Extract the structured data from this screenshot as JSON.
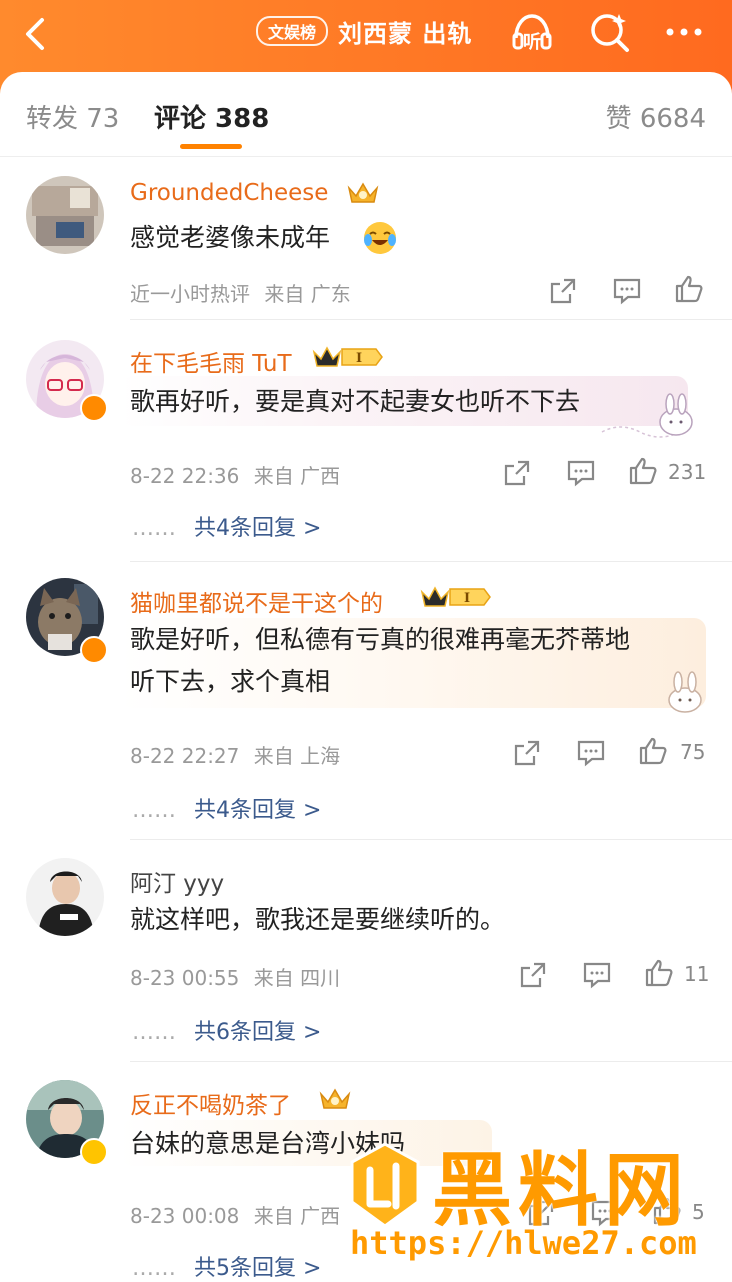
{
  "header": {
    "hot_tag": "文娱榜",
    "title": "刘西蒙 出轨",
    "listen_label": "听"
  },
  "tabs": {
    "repost": "转发 73",
    "comment": "评论 388",
    "like": "赞 6684"
  },
  "comments": [
    {
      "name": "GroundedCheese",
      "text": "感觉老婆像未成年",
      "time": "近一小时热评",
      "location": "来自 广东",
      "likes": "",
      "replies": ""
    },
    {
      "name": "在下毛毛雨 TuT",
      "text": "歌再好听，要是真对不起妻女也听不下去",
      "time": "8-22 22:36",
      "location": "来自 广西",
      "likes": "231",
      "replies": "共4条回复 >"
    },
    {
      "name": "猫咖里都说不是干这个的",
      "text_line1": "歌是好听，但私德有亏真的很难再毫无芥蒂地",
      "text_line2": "听下去，求个真相",
      "time": "8-22 22:27",
      "location": "来自 上海",
      "likes": "75",
      "replies": "共4条回复 >"
    },
    {
      "name": "阿汀 yyy",
      "text": "就这样吧，歌我还是要继续听的。",
      "time": "8-23 00:55",
      "location": "来自 四川",
      "likes": "11",
      "replies": "共6条回复 >"
    },
    {
      "name": "反正不喝奶茶了",
      "text": "台妹的意思是台湾小妹吗",
      "time": "8-23 00:08",
      "location": "来自 广西",
      "likes": "5",
      "replies": "共5条回复 >"
    }
  ],
  "reply_prefix": "……",
  "watermark": {
    "text": "黑料网",
    "url": "https://hlwe27.com"
  },
  "colors": {
    "header_orange": "#ff7a25",
    "name_orange": "#e86b1a",
    "reply_link": "#3b5a8c",
    "tab_accent": "#ff8200"
  }
}
